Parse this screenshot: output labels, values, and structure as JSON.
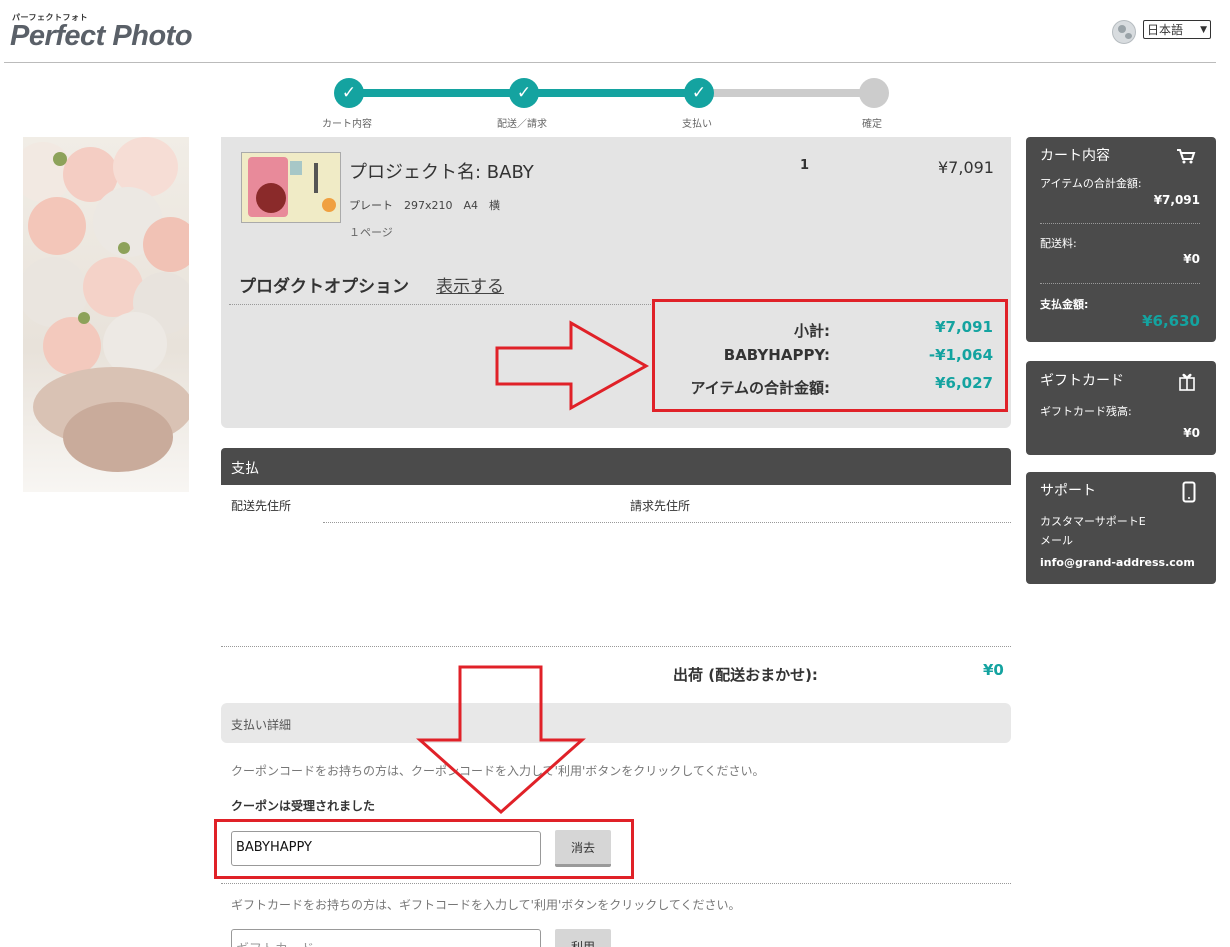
{
  "header": {
    "logo_small": "パーフェクトフォト",
    "logo_main": "Perfect Photo",
    "language": "日本語"
  },
  "stepper": {
    "steps": [
      "カート内容",
      "配送／請求",
      "支払い",
      "確定"
    ],
    "done_color": "#14a3a0",
    "todo_color": "#cccccc"
  },
  "cart": {
    "project_name": "プロジェクト名: BABY",
    "spec": "プレート　297x210　A4　横",
    "pages": "１ページ",
    "quantity": "1",
    "price": "¥7,091",
    "options_title": "プロダクトオプション",
    "options_link": "表示する",
    "summary": [
      {
        "label": "小計:",
        "value": "¥7,091"
      },
      {
        "label": "BABYHAPPY:",
        "value": "-¥1,064"
      },
      {
        "label": "アイテムの合計金額:",
        "value": "¥6,027"
      }
    ]
  },
  "payment": {
    "section_title": "支払",
    "shipping_address_label": "配送先住所",
    "billing_address_label": "請求先住所",
    "shipping_label": "出荷 (配送おまかせ):",
    "shipping_value": "¥0",
    "details_title": "支払い詳細",
    "coupon_note": "クーポンコードをお持ちの方は、クーポンコードを入力して'利用'ボタンをクリックしてください。",
    "coupon_accepted": "クーポンは受理されました",
    "coupon_value": "BABYHAPPY",
    "coupon_remove": "消去",
    "gift_note": "ギフトカードをお持ちの方は、ギフトコードを入力して'利用'ボタンをクリックしてください。",
    "gift_placeholder": "ギフトカード",
    "gift_apply": "利用"
  },
  "sidebar": {
    "cart": {
      "title": "カート内容",
      "item_total_label": "アイテムの合計金額:",
      "item_total_value": "¥7,091",
      "shipping_label": "配送料:",
      "shipping_value": "¥0",
      "pay_total_label": "支払金額:",
      "pay_total_value": "¥6,630"
    },
    "gift": {
      "title": "ギフトカード",
      "balance_label": "ギフトカード残高:",
      "balance_value": "¥0"
    },
    "support": {
      "title": "サポート",
      "email_label": "カスタマーサポートEメール",
      "email": "info@grand-address.com"
    }
  },
  "annotation_color": "#e02128",
  "accent_color": "#14a3a0"
}
